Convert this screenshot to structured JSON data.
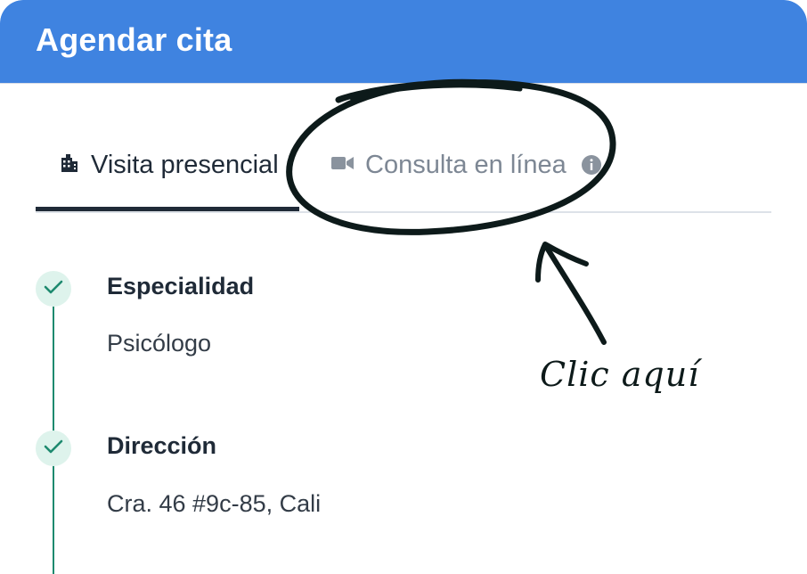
{
  "header": {
    "title": "Agendar cita"
  },
  "tabs": [
    {
      "label": "Visita presencial",
      "icon": "building-icon",
      "active": true
    },
    {
      "label": "Consulta en línea",
      "icon": "video-camera-icon",
      "active": false,
      "info_icon": "info-icon"
    }
  ],
  "steps": [
    {
      "title": "Especialidad",
      "value": "Psicólogo",
      "status_icon": "check-icon"
    },
    {
      "title": "Dirección",
      "value": "Cra. 46 #9c-85, Cali",
      "status_icon": "check-icon"
    }
  ],
  "annotation": {
    "text": "Clic aquí"
  },
  "colors": {
    "header": "#3f83e0",
    "accent_green": "#1e8a6f",
    "check_bg": "#def3ec",
    "active_text": "#1f2a37",
    "inactive_text": "#7d8794",
    "annotation_ink": "#0d1a1a"
  }
}
